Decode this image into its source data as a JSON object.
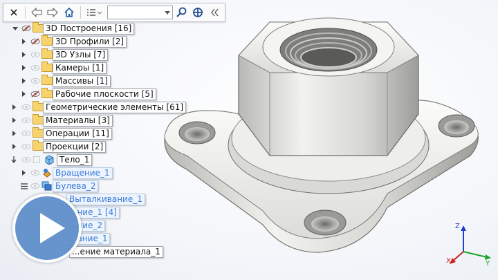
{
  "toolbar": {
    "close_icon": "close-icon",
    "back_icon": "arrow-left-icon",
    "forward_icon": "arrow-right-icon",
    "home_icon": "home-icon",
    "list_icon": "list-view-icon",
    "search_value": "",
    "search_icon": "magnifier-icon",
    "target_icon": "crosshair-icon",
    "collapse_icon": "double-chevron-left-icon"
  },
  "tree": {
    "items": [
      {
        "label": "3D Построения [16]"
      },
      {
        "label": "3D Профили [2]"
      },
      {
        "label": "3D Узлы [7]"
      },
      {
        "label": "Камеры [1]"
      },
      {
        "label": "Массивы [1]"
      },
      {
        "label": "Рабочие плоскости [5]"
      },
      {
        "label": "Геометрические элементы [61]"
      },
      {
        "label": "Материалы [3]"
      },
      {
        "label": "Операции [11]"
      },
      {
        "label": "Проекции [2]"
      },
      {
        "label": "Тело_1"
      },
      {
        "label": "Вращение_1"
      },
      {
        "label": "Булева_2"
      },
      {
        "label": "Выталкивание_1"
      },
      {
        "label": "...ние_1 [4]"
      },
      {
        "label": "...ние_2"
      },
      {
        "label": "...ание_1"
      },
      {
        "label": "...ение материала_1"
      }
    ]
  },
  "triad": {
    "x": "X",
    "y": "Y",
    "z": "Z"
  },
  "colors": {
    "accent": "#5d8dc9",
    "link": "#3a7bd5",
    "folder": "#f6d36b"
  }
}
